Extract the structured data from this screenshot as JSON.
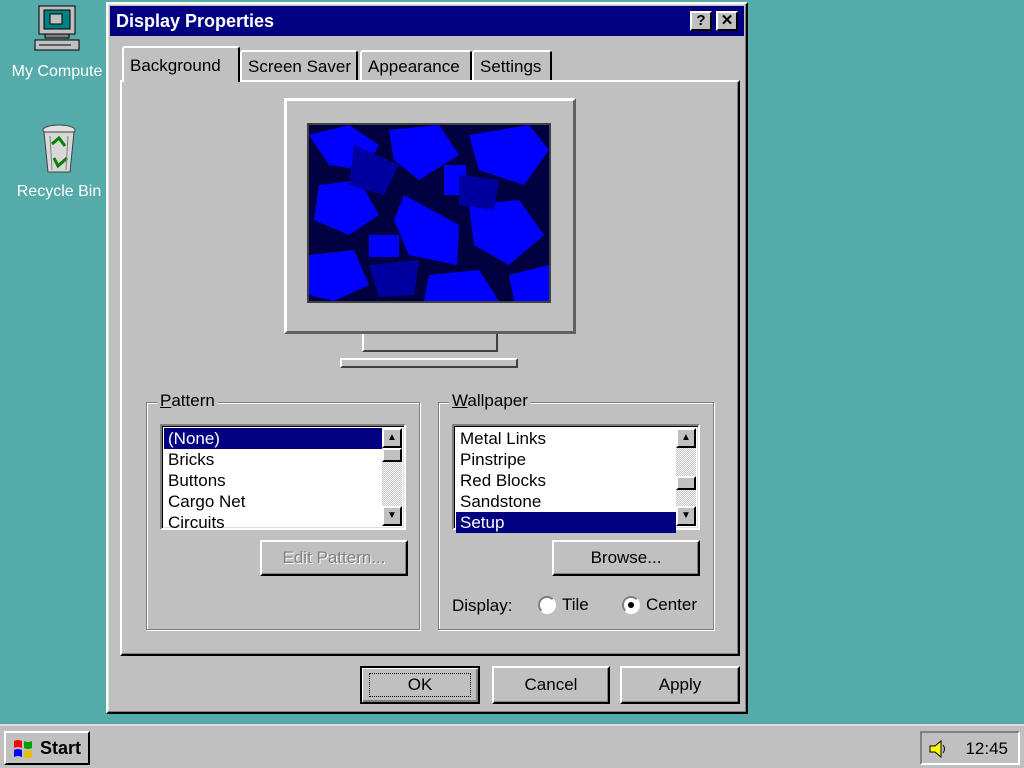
{
  "desktop": {
    "icons": [
      {
        "label": "My Compute"
      },
      {
        "label": "Recycle Bin"
      }
    ]
  },
  "window": {
    "title": "Display Properties",
    "help_label": "?",
    "close_label": "✕"
  },
  "tabs": [
    {
      "label": "Background",
      "active": true
    },
    {
      "label": "Screen Saver"
    },
    {
      "label": "Appearance"
    },
    {
      "label": "Settings"
    }
  ],
  "pattern": {
    "group_label": "Pattern",
    "items": [
      "(None)",
      "Bricks",
      "Buttons",
      "Cargo Net",
      "Circuits"
    ],
    "selected": "(None)",
    "edit_button": "Edit Pattern..."
  },
  "wallpaper": {
    "group_label": "Wallpaper",
    "items": [
      "Metal Links",
      "Pinstripe",
      "Red Blocks",
      "Sandstone",
      "Setup"
    ],
    "selected": "Setup",
    "browse_button": "Browse...",
    "display_label": "Display:",
    "display_options": [
      "Tile",
      "Center"
    ],
    "display_selected": "Center"
  },
  "buttons": {
    "ok": "OK",
    "cancel": "Cancel",
    "apply": "Apply"
  },
  "taskbar": {
    "start_label": "Start",
    "clock": "12:45"
  },
  "colors": {
    "desktop": "#55aaaa",
    "titlebar": "#000080",
    "selection": "#000080",
    "face": "#c0c0c0"
  }
}
